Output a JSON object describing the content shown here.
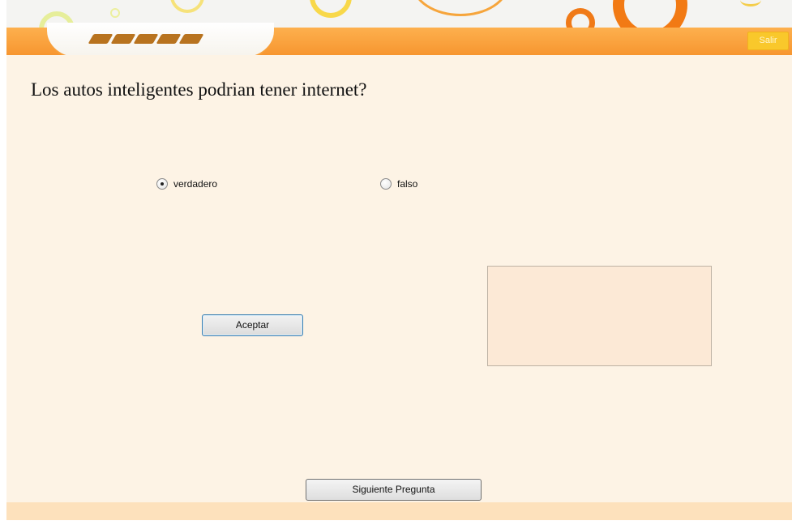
{
  "header": {
    "exit_label": "Salir"
  },
  "quiz": {
    "question": "Los autos inteligentes podrian tener internet?",
    "options": [
      {
        "label": "verdadero",
        "selected": true
      },
      {
        "label": "falso",
        "selected": false
      }
    ],
    "accept_label": "Aceptar",
    "result_text": "",
    "next_label": "Siguiente Pregunta"
  },
  "colors": {
    "header_orange": "#f79630",
    "panel_background": "#fdf3e5",
    "exit_button": "#f9c82b",
    "accept_border": "#3c7fb1"
  },
  "icons": [
    "logo-stripes-icon",
    "radio-selected-icon",
    "radio-unselected-icon"
  ]
}
